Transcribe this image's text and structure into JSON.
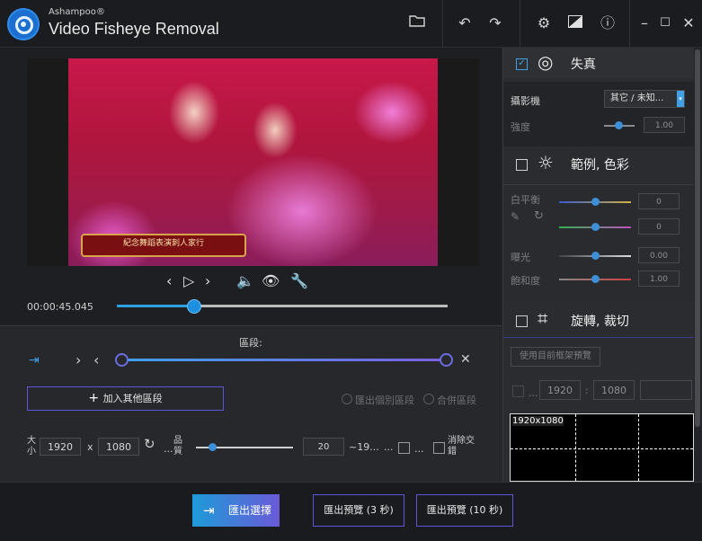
{
  "app": {
    "brand": "Ashampoo®",
    "title": "Video Fisheye Removal"
  },
  "toolbar": {
    "icons": [
      "folder-icon",
      "undo-icon",
      "redo-icon",
      "settings-icon",
      "compare-icon",
      "info-icon",
      "minimize-icon",
      "maximize-icon",
      "close-icon"
    ]
  },
  "video": {
    "banner_text": "紀念舞蹈表演刺人家行"
  },
  "playback": {
    "time": "00:00:45.045",
    "progress": 0.23
  },
  "segments": {
    "title": "區段:",
    "add_label": "加入其他區段",
    "export_each": "匯出個別區段",
    "merge": "合併區段"
  },
  "export_settings": {
    "size_label": "大小",
    "width": "1920",
    "x": "x",
    "height": "1080",
    "quality_label": "品質",
    "quality_value": "20",
    "fps_text": "~19...",
    "ellipsis1": "...",
    "ellipsis2": "...",
    "deinterlace_label": "消除交錯"
  },
  "bottom": {
    "export_selection": "匯出選擇",
    "export_preview3": "匯出預覽 (3 秒)",
    "export_preview10": "匯出預覽 (10 秒)"
  },
  "right": {
    "distortion": {
      "title": "失真",
      "camera_label": "攝影機",
      "camera_value": "其它 / 未知...",
      "strength_label": "強度",
      "strength_value": "1.00"
    },
    "color": {
      "title": "範例, 色彩",
      "wb_label": "白平衡",
      "wb1": "0",
      "wb2": "0",
      "exposure_label": "曝光",
      "exposure_value": "0.00",
      "saturation_label": "飽和度",
      "saturation_value": "1.00"
    },
    "rotate": {
      "title": "旋轉, 裁切",
      "use_frame_btn": "使用目前框架預覽",
      "ellipsis": "...",
      "w": "1920",
      "colon": ":",
      "h": "1080",
      "preview_label": "1920x1080"
    }
  }
}
